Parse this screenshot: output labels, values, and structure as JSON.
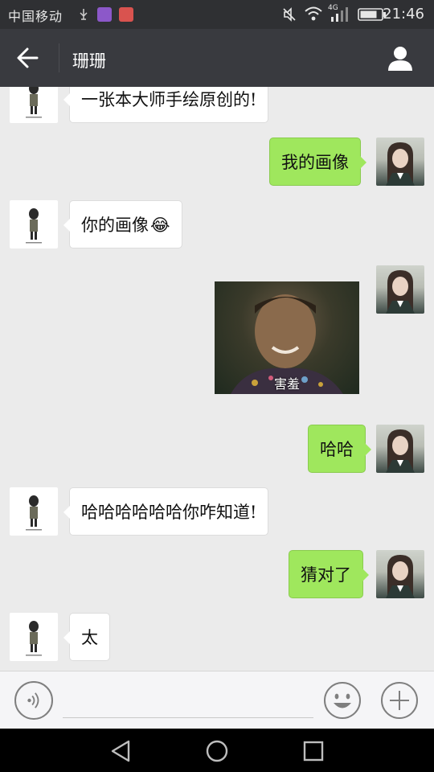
{
  "status_bar": {
    "carrier": "中国移动",
    "network": "4G",
    "time": "21:46"
  },
  "header": {
    "title": "珊珊",
    "icons": {
      "back": "back-arrow-icon",
      "profile": "person-icon"
    }
  },
  "messages": [
    {
      "side": "left",
      "type": "text",
      "text": "一张本大师手绘原创的!"
    },
    {
      "side": "right",
      "type": "text",
      "text": "我的画像"
    },
    {
      "side": "left",
      "type": "text",
      "text": "你的画像",
      "emoji": "😂"
    },
    {
      "side": "right",
      "type": "sticker",
      "caption": "害羞"
    },
    {
      "side": "right",
      "type": "text",
      "text": "哈哈"
    },
    {
      "side": "left",
      "type": "text",
      "text": "哈哈哈哈哈哈你咋知道!"
    },
    {
      "side": "right",
      "type": "text",
      "text": "猜对了"
    },
    {
      "side": "left",
      "type": "text",
      "text": "太"
    }
  ],
  "input_bar": {
    "value": "",
    "icons": {
      "voice": "voice-icon",
      "emoji": "emoji-icon",
      "more": "plus-icon"
    }
  },
  "nav_bar": {
    "icons": [
      "back-triangle-icon",
      "home-circle-icon",
      "recent-square-icon"
    ]
  },
  "colors": {
    "header_bg": "#393a3f",
    "status_bg": "#2f3033",
    "chat_bg": "#ebebeb",
    "sent_bubble": "#9fe75d",
    "received_bubble": "#ffffff"
  }
}
